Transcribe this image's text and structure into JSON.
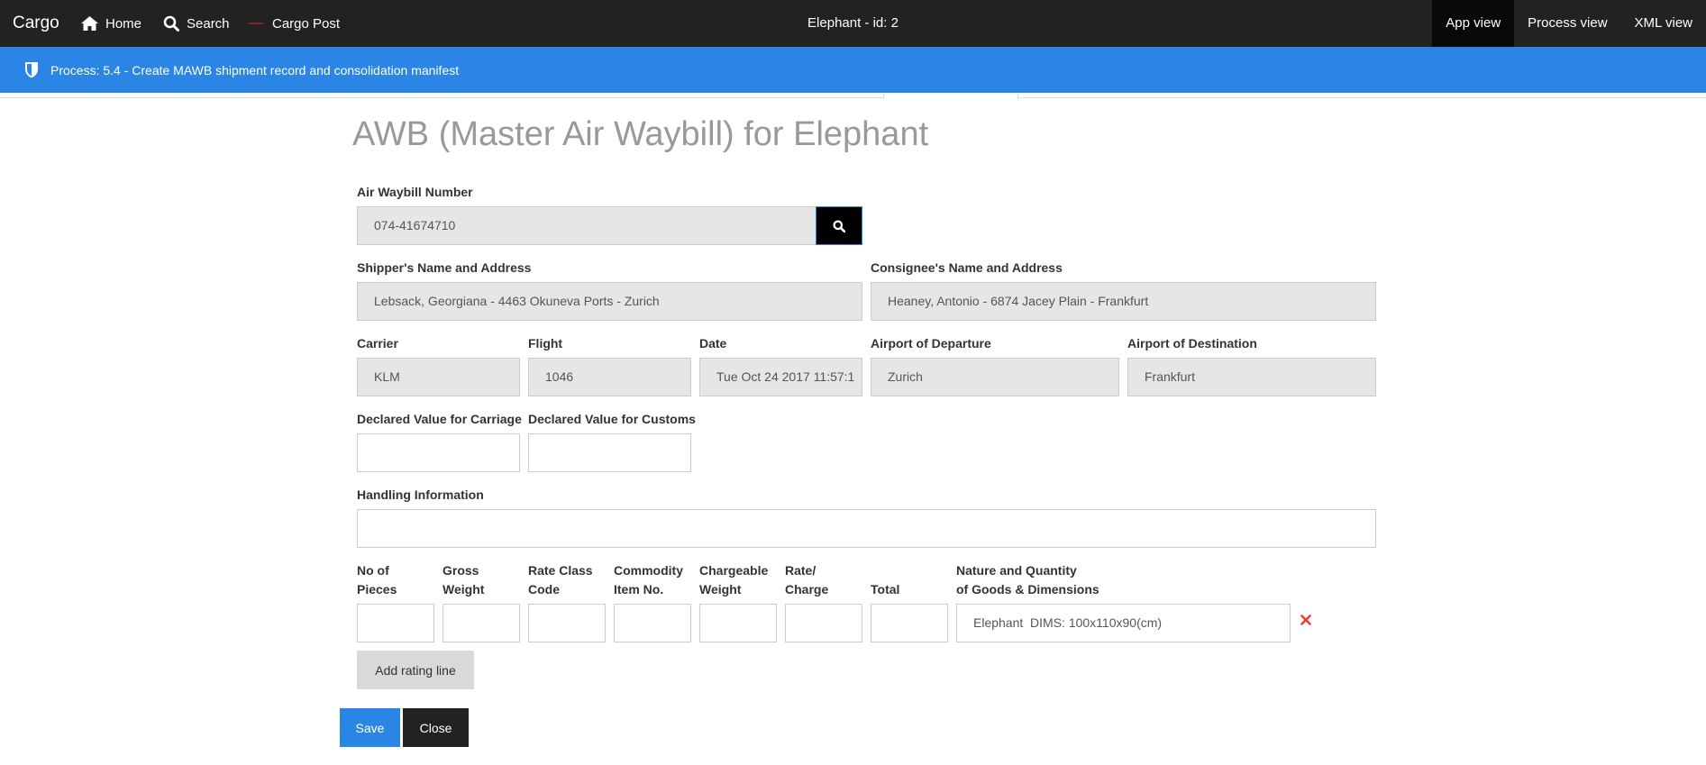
{
  "navbar": {
    "brand": "Cargo",
    "home_label": "Home",
    "search_label": "Search",
    "cargo_post_label": "Cargo Post",
    "center_title": "Elephant - id: 2",
    "views": [
      "App view",
      "Process view",
      "XML view"
    ],
    "active_view": "App view"
  },
  "process": {
    "text": "Process: 5.4 - Create MAWB shipment record and consolidation manifest"
  },
  "form": {
    "title": "AWB (Master Air Waybill) for Elephant",
    "awb_number": {
      "label": "Air Waybill Number",
      "value": "074-41674710"
    },
    "shipper": {
      "label": "Shipper's Name and Address",
      "value": "Lebsack, Georgiana - 4463 Okuneva Ports - Zurich"
    },
    "consignee": {
      "label": "Consignee's Name and Address",
      "value": "Heaney, Antonio - 6874 Jacey Plain - Frankfurt"
    },
    "carrier": {
      "label": "Carrier",
      "value": "KLM"
    },
    "flight": {
      "label": "Flight",
      "value": "1046"
    },
    "date": {
      "label": "Date",
      "value": "Tue Oct 24 2017 11:57:1"
    },
    "departure": {
      "label": "Airport of Departure",
      "value": "Zurich"
    },
    "destination": {
      "label": "Airport of Destination",
      "value": "Frankfurt"
    },
    "value_carriage": {
      "label": "Declared Value for Carriage",
      "value": ""
    },
    "value_customs": {
      "label": "Declared Value for Customs",
      "value": ""
    },
    "handling": {
      "label": "Handling Information",
      "value": ""
    },
    "rating": {
      "headers": [
        [
          "No of",
          "Pieces"
        ],
        [
          "Gross",
          "Weight"
        ],
        [
          "Rate Class",
          "Code"
        ],
        [
          "Commodity",
          "Item No."
        ],
        [
          "Chargeable",
          "Weight"
        ],
        [
          "Rate/",
          "Charge"
        ],
        [
          "",
          "Total"
        ],
        [
          "Nature and Quantity",
          "of Goods & Dimensions"
        ]
      ],
      "row": [
        "",
        "",
        "",
        "",
        "",
        "",
        "",
        "Elephant  DIMS: 100x110x90(cm)"
      ]
    },
    "add_line_label": "Add rating line",
    "save_label": "Save",
    "close_label": "Close"
  },
  "colors": {
    "navbar": "#222222",
    "active_tab": "#080808",
    "accent": "#2a85e4",
    "readonly_field": "#e6e6e6",
    "remove": "#e8403a"
  }
}
